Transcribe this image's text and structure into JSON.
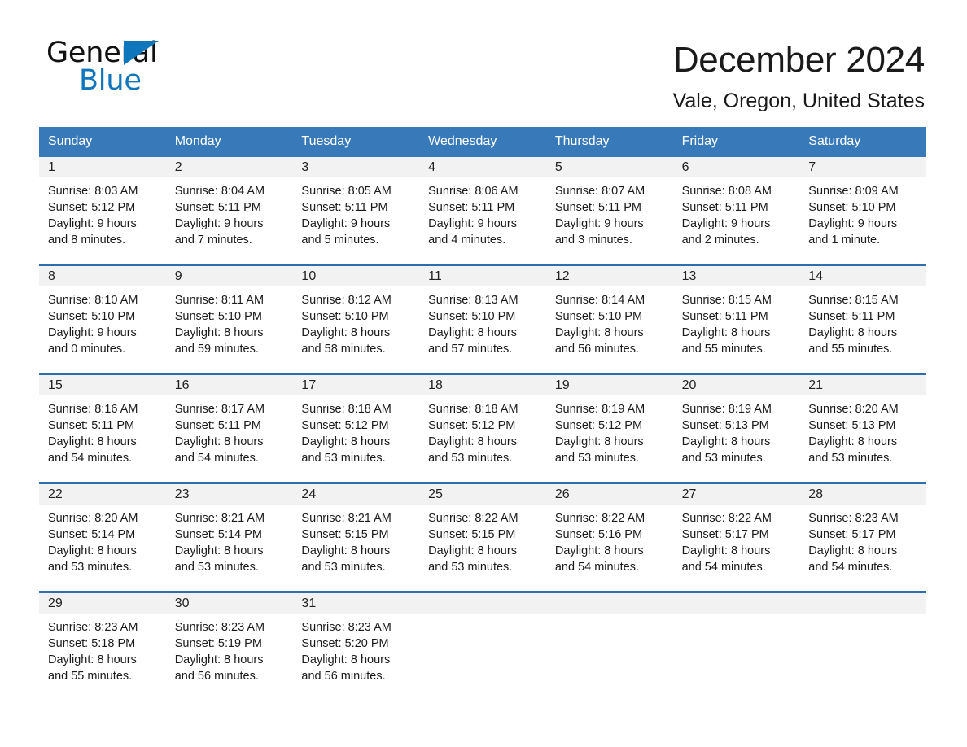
{
  "brand": {
    "name_part1": "General",
    "name_part2": "Blue",
    "accent_color": "#1076bc"
  },
  "header": {
    "month_title": "December 2024",
    "location": "Vale, Oregon, United States"
  },
  "theme": {
    "header_row_bg": "#3879b9",
    "week_divider": "#2e6ead",
    "daynum_band_bg": "#f2f2f2"
  },
  "calendar": {
    "day_headers": [
      "Sunday",
      "Monday",
      "Tuesday",
      "Wednesday",
      "Thursday",
      "Friday",
      "Saturday"
    ],
    "weeks": [
      [
        {
          "day": "1",
          "sunrise": "Sunrise: 8:03 AM",
          "sunset": "Sunset: 5:12 PM",
          "daylight_1": "Daylight: 9 hours",
          "daylight_2": "and 8 minutes."
        },
        {
          "day": "2",
          "sunrise": "Sunrise: 8:04 AM",
          "sunset": "Sunset: 5:11 PM",
          "daylight_1": "Daylight: 9 hours",
          "daylight_2": "and 7 minutes."
        },
        {
          "day": "3",
          "sunrise": "Sunrise: 8:05 AM",
          "sunset": "Sunset: 5:11 PM",
          "daylight_1": "Daylight: 9 hours",
          "daylight_2": "and 5 minutes."
        },
        {
          "day": "4",
          "sunrise": "Sunrise: 8:06 AM",
          "sunset": "Sunset: 5:11 PM",
          "daylight_1": "Daylight: 9 hours",
          "daylight_2": "and 4 minutes."
        },
        {
          "day": "5",
          "sunrise": "Sunrise: 8:07 AM",
          "sunset": "Sunset: 5:11 PM",
          "daylight_1": "Daylight: 9 hours",
          "daylight_2": "and 3 minutes."
        },
        {
          "day": "6",
          "sunrise": "Sunrise: 8:08 AM",
          "sunset": "Sunset: 5:11 PM",
          "daylight_1": "Daylight: 9 hours",
          "daylight_2": "and 2 minutes."
        },
        {
          "day": "7",
          "sunrise": "Sunrise: 8:09 AM",
          "sunset": "Sunset: 5:10 PM",
          "daylight_1": "Daylight: 9 hours",
          "daylight_2": "and 1 minute."
        }
      ],
      [
        {
          "day": "8",
          "sunrise": "Sunrise: 8:10 AM",
          "sunset": "Sunset: 5:10 PM",
          "daylight_1": "Daylight: 9 hours",
          "daylight_2": "and 0 minutes."
        },
        {
          "day": "9",
          "sunrise": "Sunrise: 8:11 AM",
          "sunset": "Sunset: 5:10 PM",
          "daylight_1": "Daylight: 8 hours",
          "daylight_2": "and 59 minutes."
        },
        {
          "day": "10",
          "sunrise": "Sunrise: 8:12 AM",
          "sunset": "Sunset: 5:10 PM",
          "daylight_1": "Daylight: 8 hours",
          "daylight_2": "and 58 minutes."
        },
        {
          "day": "11",
          "sunrise": "Sunrise: 8:13 AM",
          "sunset": "Sunset: 5:10 PM",
          "daylight_1": "Daylight: 8 hours",
          "daylight_2": "and 57 minutes."
        },
        {
          "day": "12",
          "sunrise": "Sunrise: 8:14 AM",
          "sunset": "Sunset: 5:10 PM",
          "daylight_1": "Daylight: 8 hours",
          "daylight_2": "and 56 minutes."
        },
        {
          "day": "13",
          "sunrise": "Sunrise: 8:15 AM",
          "sunset": "Sunset: 5:11 PM",
          "daylight_1": "Daylight: 8 hours",
          "daylight_2": "and 55 minutes."
        },
        {
          "day": "14",
          "sunrise": "Sunrise: 8:15 AM",
          "sunset": "Sunset: 5:11 PM",
          "daylight_1": "Daylight: 8 hours",
          "daylight_2": "and 55 minutes."
        }
      ],
      [
        {
          "day": "15",
          "sunrise": "Sunrise: 8:16 AM",
          "sunset": "Sunset: 5:11 PM",
          "daylight_1": "Daylight: 8 hours",
          "daylight_2": "and 54 minutes."
        },
        {
          "day": "16",
          "sunrise": "Sunrise: 8:17 AM",
          "sunset": "Sunset: 5:11 PM",
          "daylight_1": "Daylight: 8 hours",
          "daylight_2": "and 54 minutes."
        },
        {
          "day": "17",
          "sunrise": "Sunrise: 8:18 AM",
          "sunset": "Sunset: 5:12 PM",
          "daylight_1": "Daylight: 8 hours",
          "daylight_2": "and 53 minutes."
        },
        {
          "day": "18",
          "sunrise": "Sunrise: 8:18 AM",
          "sunset": "Sunset: 5:12 PM",
          "daylight_1": "Daylight: 8 hours",
          "daylight_2": "and 53 minutes."
        },
        {
          "day": "19",
          "sunrise": "Sunrise: 8:19 AM",
          "sunset": "Sunset: 5:12 PM",
          "daylight_1": "Daylight: 8 hours",
          "daylight_2": "and 53 minutes."
        },
        {
          "day": "20",
          "sunrise": "Sunrise: 8:19 AM",
          "sunset": "Sunset: 5:13 PM",
          "daylight_1": "Daylight: 8 hours",
          "daylight_2": "and 53 minutes."
        },
        {
          "day": "21",
          "sunrise": "Sunrise: 8:20 AM",
          "sunset": "Sunset: 5:13 PM",
          "daylight_1": "Daylight: 8 hours",
          "daylight_2": "and 53 minutes."
        }
      ],
      [
        {
          "day": "22",
          "sunrise": "Sunrise: 8:20 AM",
          "sunset": "Sunset: 5:14 PM",
          "daylight_1": "Daylight: 8 hours",
          "daylight_2": "and 53 minutes."
        },
        {
          "day": "23",
          "sunrise": "Sunrise: 8:21 AM",
          "sunset": "Sunset: 5:14 PM",
          "daylight_1": "Daylight: 8 hours",
          "daylight_2": "and 53 minutes."
        },
        {
          "day": "24",
          "sunrise": "Sunrise: 8:21 AM",
          "sunset": "Sunset: 5:15 PM",
          "daylight_1": "Daylight: 8 hours",
          "daylight_2": "and 53 minutes."
        },
        {
          "day": "25",
          "sunrise": "Sunrise: 8:22 AM",
          "sunset": "Sunset: 5:15 PM",
          "daylight_1": "Daylight: 8 hours",
          "daylight_2": "and 53 minutes."
        },
        {
          "day": "26",
          "sunrise": "Sunrise: 8:22 AM",
          "sunset": "Sunset: 5:16 PM",
          "daylight_1": "Daylight: 8 hours",
          "daylight_2": "and 54 minutes."
        },
        {
          "day": "27",
          "sunrise": "Sunrise: 8:22 AM",
          "sunset": "Sunset: 5:17 PM",
          "daylight_1": "Daylight: 8 hours",
          "daylight_2": "and 54 minutes."
        },
        {
          "day": "28",
          "sunrise": "Sunrise: 8:23 AM",
          "sunset": "Sunset: 5:17 PM",
          "daylight_1": "Daylight: 8 hours",
          "daylight_2": "and 54 minutes."
        }
      ],
      [
        {
          "day": "29",
          "sunrise": "Sunrise: 8:23 AM",
          "sunset": "Sunset: 5:18 PM",
          "daylight_1": "Daylight: 8 hours",
          "daylight_2": "and 55 minutes."
        },
        {
          "day": "30",
          "sunrise": "Sunrise: 8:23 AM",
          "sunset": "Sunset: 5:19 PM",
          "daylight_1": "Daylight: 8 hours",
          "daylight_2": "and 56 minutes."
        },
        {
          "day": "31",
          "sunrise": "Sunrise: 8:23 AM",
          "sunset": "Sunset: 5:20 PM",
          "daylight_1": "Daylight: 8 hours",
          "daylight_2": "and 56 minutes."
        },
        {
          "day": "",
          "sunrise": "",
          "sunset": "",
          "daylight_1": "",
          "daylight_2": ""
        },
        {
          "day": "",
          "sunrise": "",
          "sunset": "",
          "daylight_1": "",
          "daylight_2": ""
        },
        {
          "day": "",
          "sunrise": "",
          "sunset": "",
          "daylight_1": "",
          "daylight_2": ""
        },
        {
          "day": "",
          "sunrise": "",
          "sunset": "",
          "daylight_1": "",
          "daylight_2": ""
        }
      ]
    ]
  }
}
